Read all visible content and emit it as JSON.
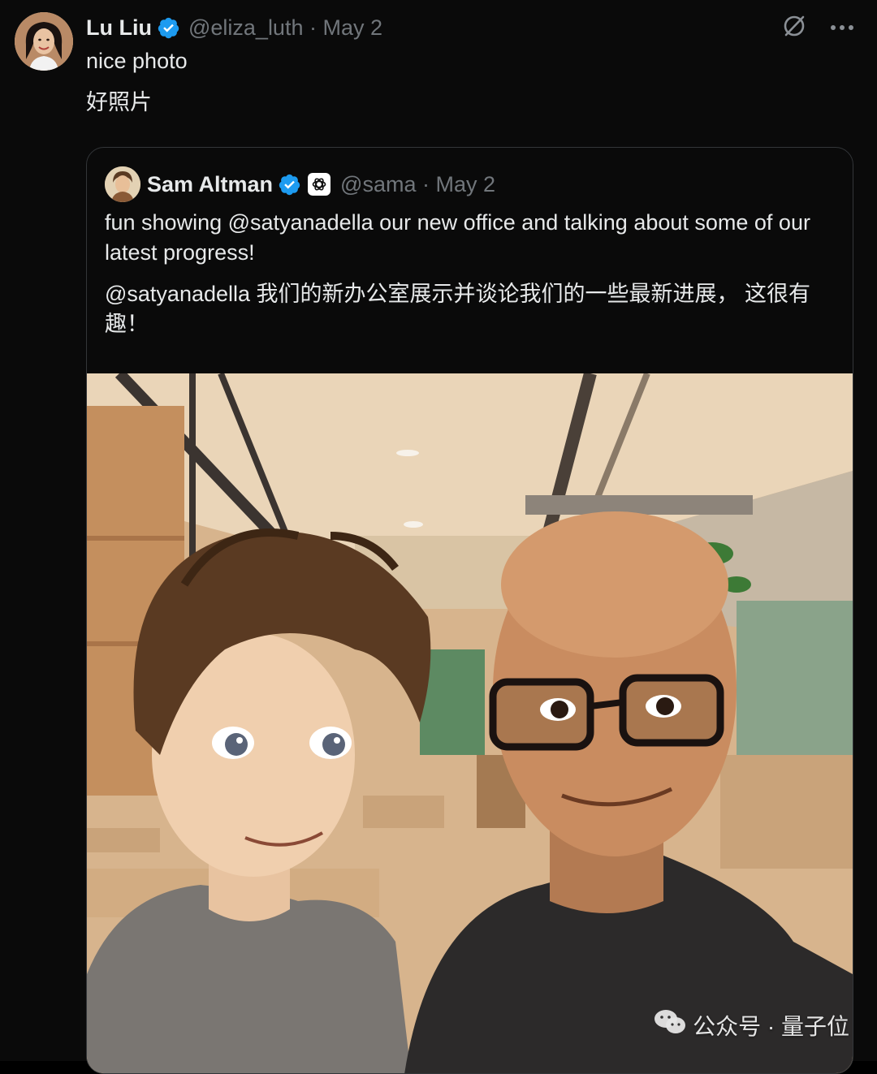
{
  "post": {
    "author_name": "Lu Liu",
    "handle_date": "@eliza_luth · May 2",
    "text_en": "nice photo",
    "text_zh": "好照片",
    "icons": [
      "verified-badge-icon",
      "grok-icon",
      "more-icon"
    ]
  },
  "quote": {
    "author_name": "Sam Altman",
    "handle_date": "@sama · May 2",
    "text_en": "fun showing @satyanadella our new office and talking about some of our latest progress!",
    "text_zh": "@satyanadella 我们的新办公室展示并谈论我们的一些最新进展， 这很有趣！",
    "icons": [
      "verified-badge-icon",
      "openai-logo-icon"
    ],
    "image_alt": "anime-style selfie illustration of two men in an office"
  },
  "watermark": {
    "text": "公众号 · 量子位",
    "icon": "wechat-icon"
  },
  "colors": {
    "background": "#0a0a0a",
    "text_primary": "#e7e9ea",
    "text_secondary": "#71767b",
    "verified_blue": "#1d9bf0",
    "border": "#333639"
  }
}
